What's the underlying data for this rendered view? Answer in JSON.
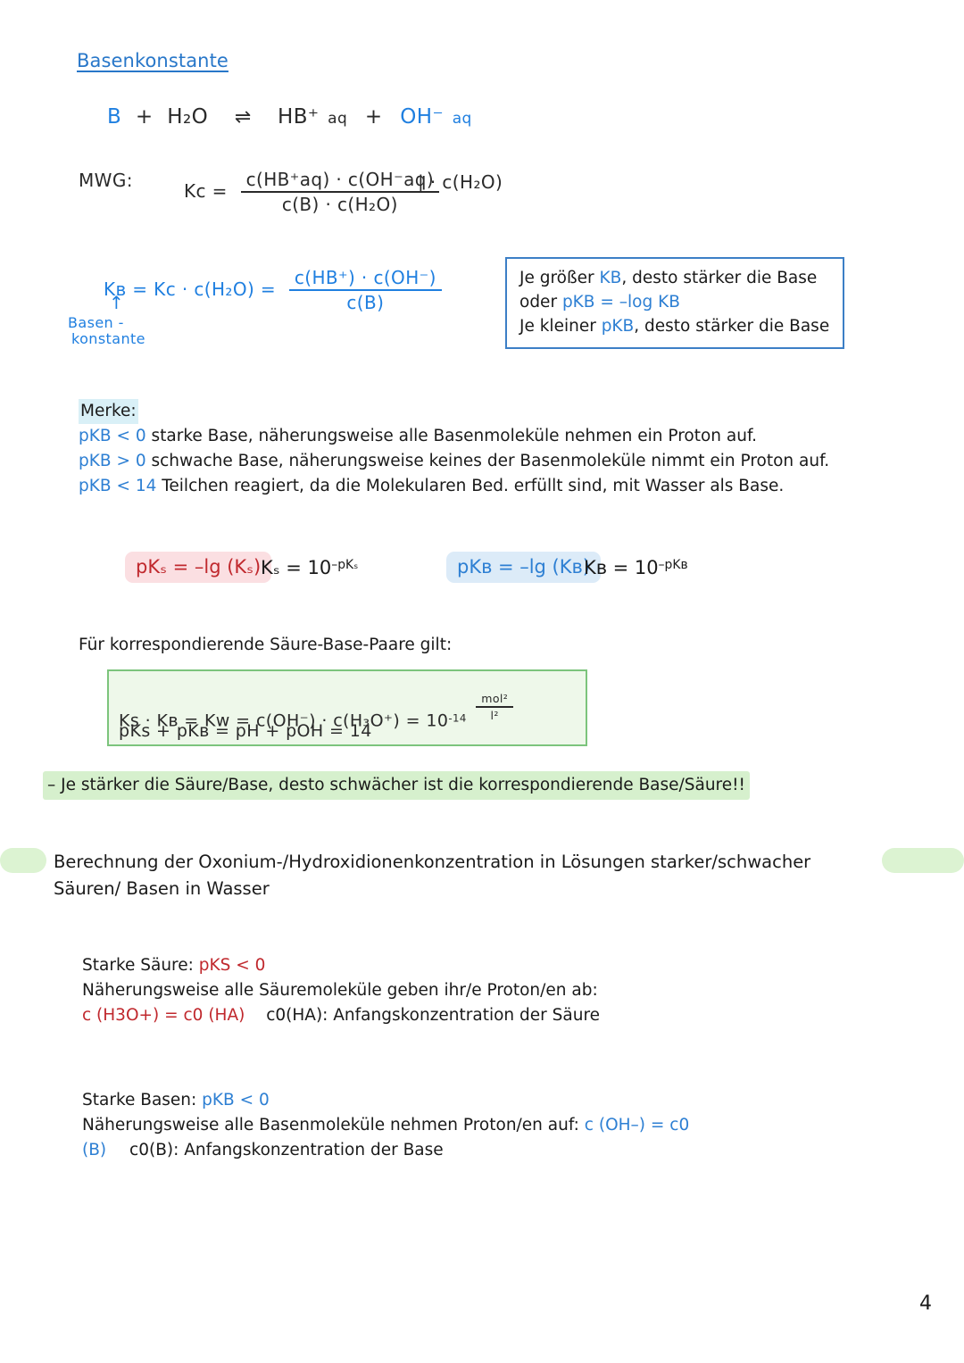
{
  "document": {
    "title": "Basenkonstante",
    "page_number": "4"
  },
  "reaction": {
    "base": "B",
    "plus1": "+",
    "water": "H₂O",
    "arrow": "⇌",
    "acid_conj": "HB⁺",
    "acid_state": "aq",
    "plus2": "+",
    "hydroxide": "OH⁻",
    "hydroxide_state": "aq"
  },
  "mwg": {
    "label": "MWG:",
    "kc_lhs": "Kc =",
    "numerator": "c(HB⁺aq) · c(OH⁻aq)",
    "denominator": "c(B) · c(H₂O)",
    "operation": "| · c(H₂O)"
  },
  "kb_formula": {
    "lhs": "Kʙ = Kc · c(H₂O) =",
    "numerator": "c(HB⁺) · c(OH⁻)",
    "denominator": "c(B)",
    "annotation_arrow": "↑",
    "annotation_line1": "Basen -",
    "annotation_line2": "konstante"
  },
  "info_box": {
    "line1_a": "Je größer ",
    "line1_b": "KB",
    "line1_c": ", desto stärker die Base",
    "line2_a": "oder ",
    "line2_b": "pKB = –log KB",
    "line3_a": "Je kleiner ",
    "line3_b": "pKB",
    "line3_c": ", desto stärker die Base"
  },
  "merke": {
    "title": "Merke:",
    "lines": [
      {
        "accent": "pKB < 0",
        "text": " starke Base, näherungsweise alle Basenmoleküle nehmen ein Proton auf."
      },
      {
        "accent": "pKB > 0",
        "text": " schwache Base, näherungsweise keines der Basenmoleküle nimmt ein Proton auf."
      },
      {
        "accent": "pKB < 14",
        "text": " Teilchen reagiert, da die Molekularen Bed. erfüllt sind, mit Wasser als Base."
      }
    ]
  },
  "formulas": {
    "pks_pill": "pKₛ = –lg (Kₛ)",
    "ks_plain": "Kₛ = 10",
    "ks_exponent": "–pKₛ",
    "pkb_pill": "pKʙ = –lg (Kʙ)",
    "kb_plain": "Kʙ = 10",
    "kb_exponent": "–pKʙ"
  },
  "korrespondierend": {
    "intro": "Für korrespondierende Säure-Base-Paare gilt:",
    "line1": "Ks · Kʙ  =   Kᴡ  =   c(OH⁻)  · c(H₃O⁺) =  10",
    "line1_exp": "-14",
    "line1_unit_num": "mol²",
    "line1_unit_den": "l²",
    "line2": "pKs + pKʙ =  pH  +   pOH   =   14"
  },
  "green_note": "– Je stärker die Säure/Base, desto schwächer ist die korrespondierende Base/Säure!!",
  "berechnung": {
    "line1": "Berechnung der Oxonium-/Hydroxidionenkonzentration in Lösungen starker/schwacher",
    "line2": "Säuren/ Basen in Wasser"
  },
  "starke_saeure": {
    "line1_a": "Starke Säure: ",
    "line1_b": "pKS < 0",
    "line2": "Näherungsweise alle Säuremoleküle geben ihr/e Proton/en ab:",
    "line3_a": "c (H3O+) = c0 (HA)",
    "line3_b": "c0(HA): Anfangskonzentration der Säure"
  },
  "starke_basen": {
    "line1_a": "Starke Basen: ",
    "line1_b": "pKB < 0",
    "line2_a": "Näherungsweise alle Basenmoleküle nehmen Proton/en auf: ",
    "line2_b": "c (OH–) = c0",
    "line3_a": "(B)",
    "line3_b": "c0(B): Anfangskonzentration der Base"
  },
  "colors": {
    "blue_accent": "#2d7fd3",
    "red_accent": "#c0282d",
    "green_highlight": "#d6f0cd",
    "heading_blue": "#2877c9"
  }
}
